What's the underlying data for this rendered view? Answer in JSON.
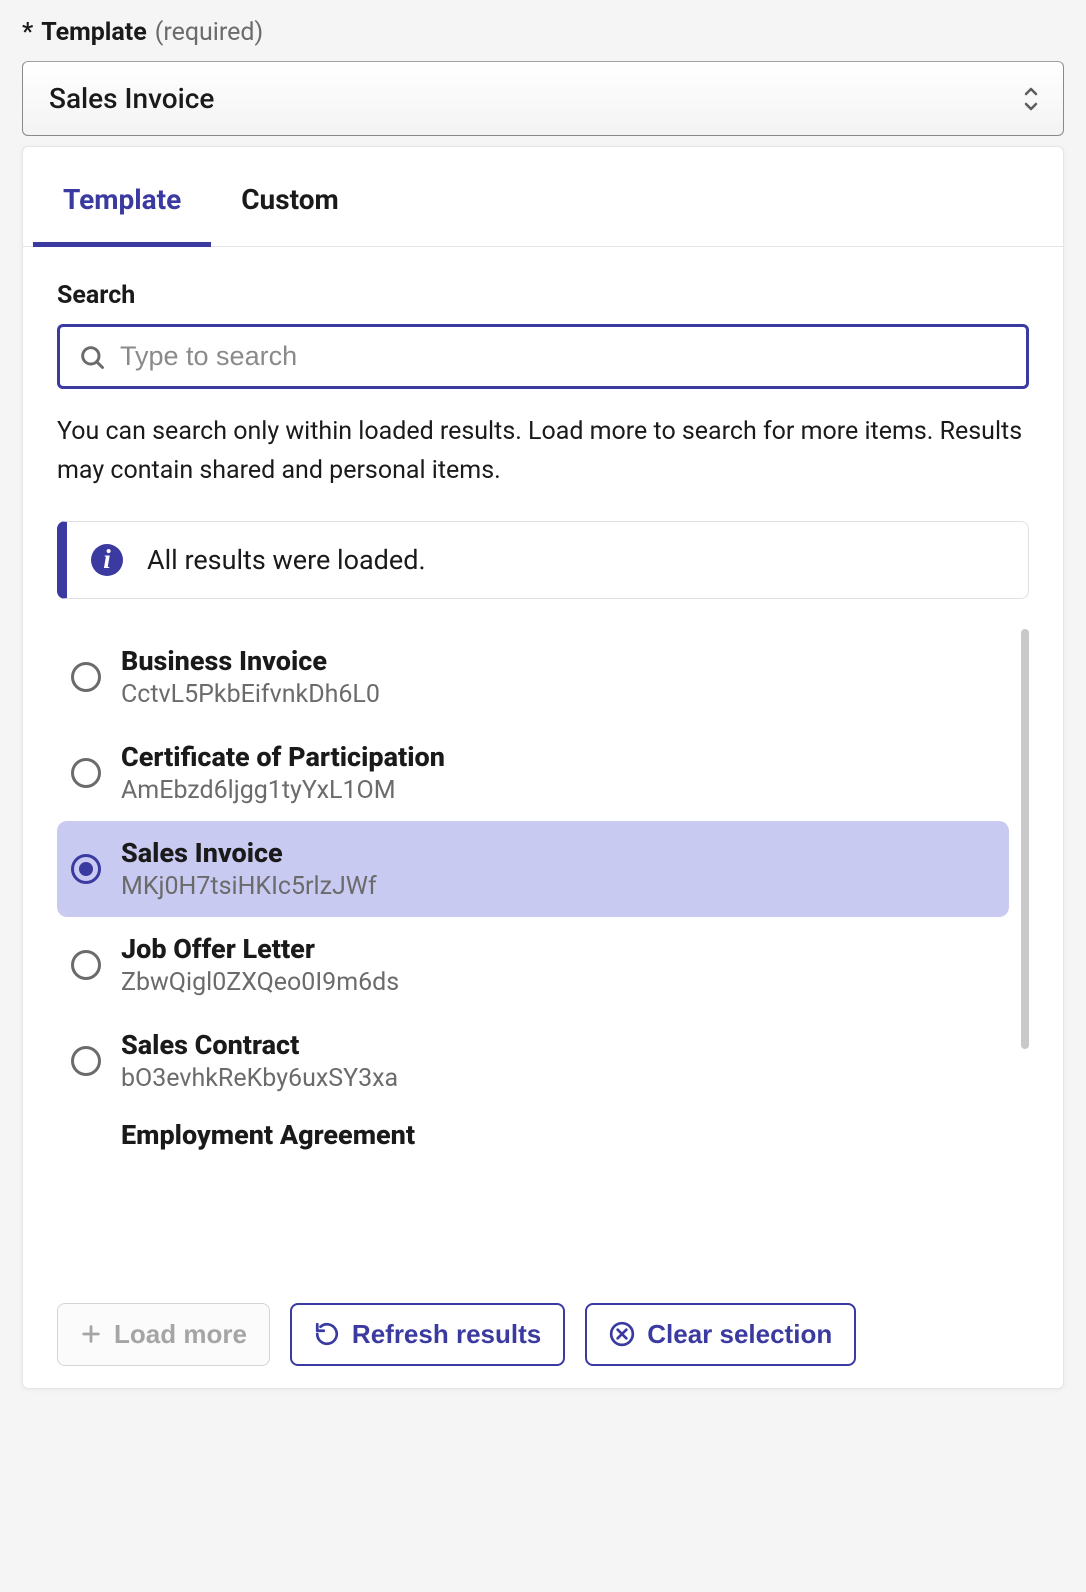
{
  "field": {
    "label": "Template",
    "required_text": "(required)",
    "asterisk": "*",
    "selected_value": "Sales Invoice"
  },
  "dropdown": {
    "tabs": [
      {
        "label": "Template",
        "active": true
      },
      {
        "label": "Custom",
        "active": false
      }
    ],
    "search": {
      "label": "Search",
      "placeholder": "Type to search"
    },
    "help_text": "You can search only within loaded results. Load more to search for more items. Results may contain shared and personal items.",
    "info_banner": "All results were loaded.",
    "results": [
      {
        "title": "Business Invoice",
        "subtitle": "CctvL5PkbEifvnkDh6L0",
        "selected": false
      },
      {
        "title": "Certificate of Participation",
        "subtitle": "AmEbzd6ljgg1tyYxL1OM",
        "selected": false
      },
      {
        "title": "Sales Invoice",
        "subtitle": "MKj0H7tsiHKIc5rlzJWf",
        "selected": true
      },
      {
        "title": "Job Offer Letter",
        "subtitle": "ZbwQigl0ZXQeo0I9m6ds",
        "selected": false
      },
      {
        "title": "Sales Contract",
        "subtitle": "bO3evhkReKby6uxSY3xa",
        "selected": false
      }
    ],
    "next_peek": "Employment Agreement",
    "footer": {
      "load_more": "Load more",
      "refresh": "Refresh results",
      "clear": "Clear selection"
    }
  }
}
